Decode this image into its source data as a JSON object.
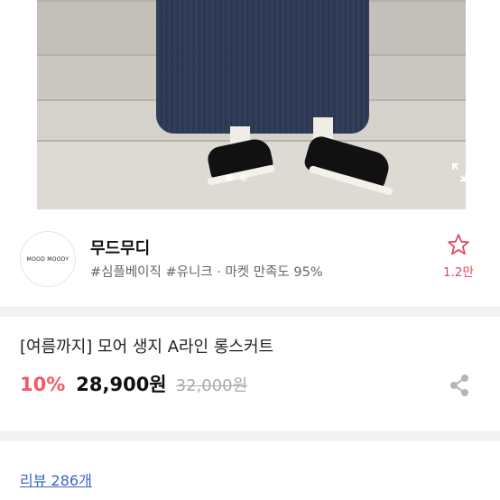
{
  "photo": {
    "slide_dots": 2,
    "active_dot": 0
  },
  "shop": {
    "logo_text": "MOOD MOODY",
    "name": "무드무디",
    "tags": "#심플베이직 #유니크 · 마켓 만족도 95%",
    "favorite_count": "1.2만"
  },
  "product": {
    "title": "[여름까지] 모어 생지 A라인 롱스커트",
    "discount": "10%",
    "price": "28,900원",
    "original_price": "32,000원"
  },
  "reviews": {
    "label": "리뷰 286개"
  },
  "colors": {
    "accent_pink": "#f15a6a",
    "favorite_pink": "#e0455f",
    "link_blue": "#3b63c9"
  }
}
